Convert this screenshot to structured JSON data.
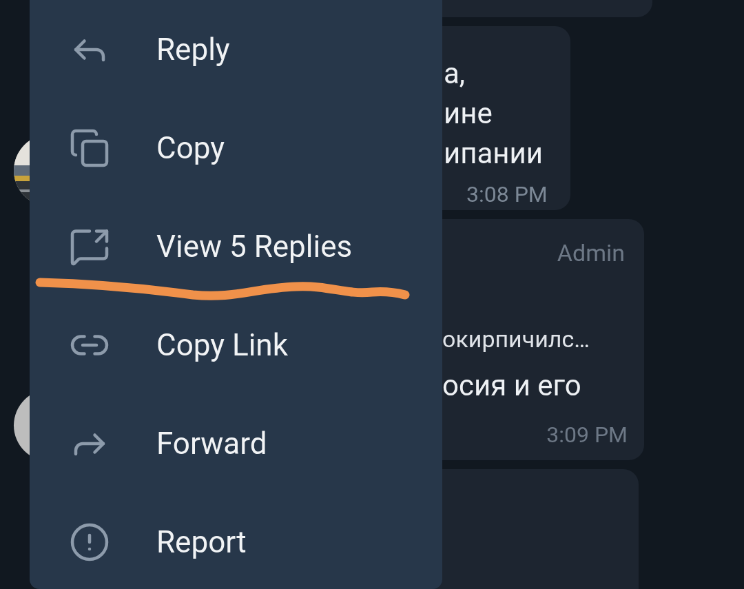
{
  "chat": {
    "messages": [
      {
        "lines": [
          "а,",
          "ине",
          "ипании"
        ],
        "time": "3:08 PM"
      },
      {
        "sender": "Admin",
        "quote": "окирпичилс…",
        "lines": [
          "осия и его"
        ],
        "time": "3:09 PM"
      }
    ]
  },
  "context_menu": {
    "items": [
      {
        "label": "Reply"
      },
      {
        "label": "Copy"
      },
      {
        "label": "View 5 Replies"
      },
      {
        "label": "Copy Link"
      },
      {
        "label": "Forward"
      },
      {
        "label": "Report"
      }
    ]
  }
}
